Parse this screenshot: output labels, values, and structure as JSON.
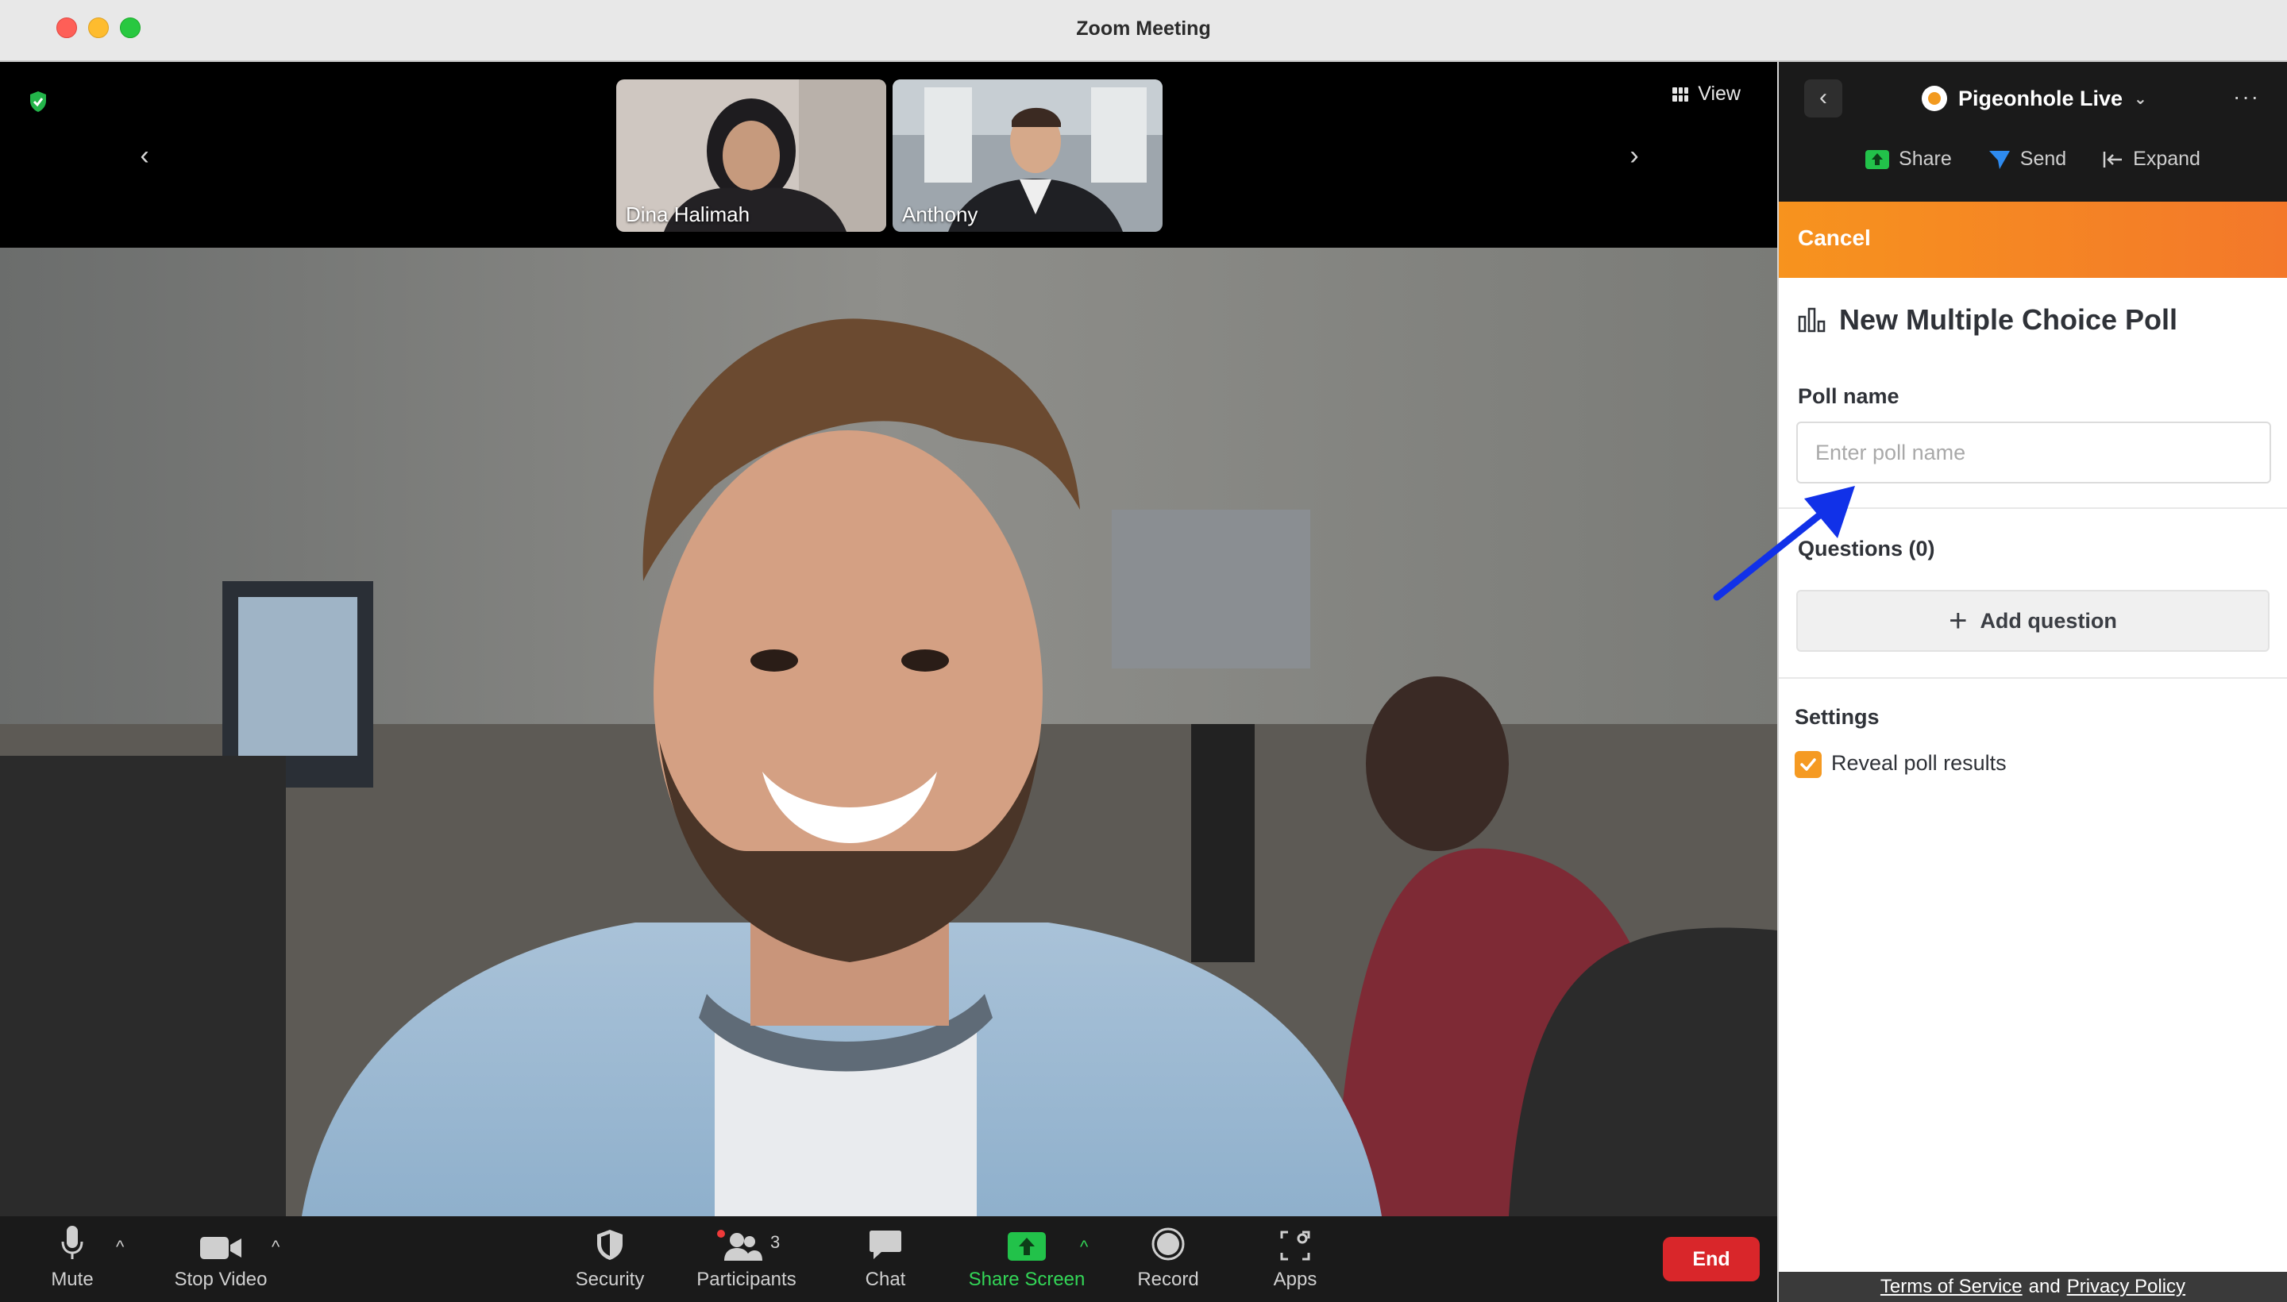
{
  "window": {
    "title": "Zoom Meeting"
  },
  "gallery": {
    "participants": [
      {
        "name": "Dina Halimah"
      },
      {
        "name": "Anthony"
      }
    ],
    "view_label": "View"
  },
  "toolbar": {
    "mute_label": "Mute",
    "stop_video_label": "Stop Video",
    "security_label": "Security",
    "participants_label": "Participants",
    "participants_count": "3",
    "chat_label": "Chat",
    "share_screen_label": "Share Screen",
    "record_label": "Record",
    "apps_label": "Apps",
    "end_label": "End"
  },
  "panel": {
    "app_name": "Pigeonhole Live",
    "actions": {
      "share": "Share",
      "send": "Send",
      "expand": "Expand"
    },
    "cancel_label": "Cancel",
    "poll_title": "New Multiple Choice Poll",
    "poll_name_label": "Poll name",
    "poll_name_placeholder": "Enter poll name",
    "poll_name_value": "",
    "questions_label": "Questions (0)",
    "add_question_label": "Add question",
    "settings_label": "Settings",
    "reveal_results_label": "Reveal poll results",
    "reveal_results_checked": true,
    "footer": {
      "terms": "Terms of Service",
      "and": "and",
      "privacy": "Privacy Policy"
    }
  },
  "colors": {
    "accent_orange": "#f7931e",
    "green": "#33d657",
    "end_red": "#d9262a",
    "annotation_blue": "#1131e8"
  }
}
